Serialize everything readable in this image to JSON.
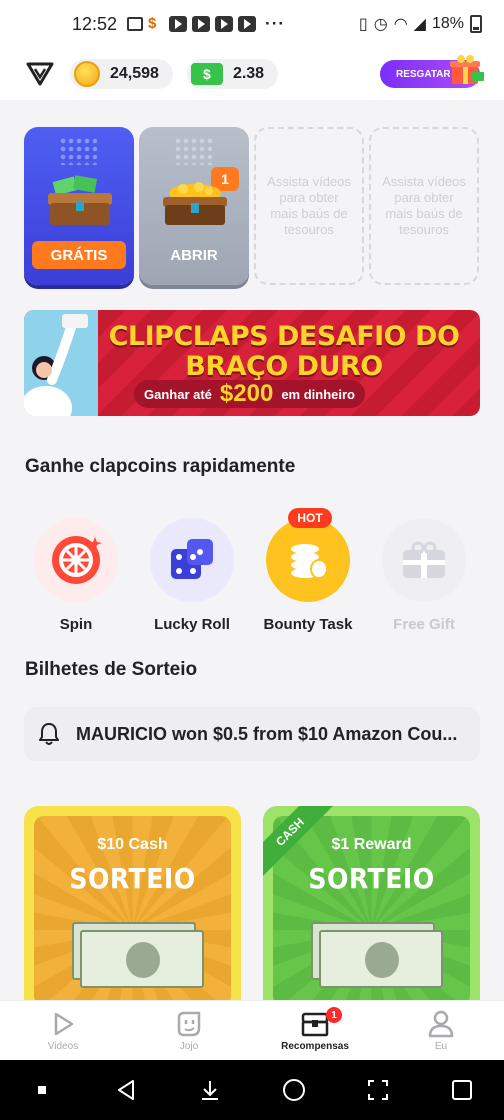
{
  "status_bar": {
    "time": "12:52",
    "battery": "18%"
  },
  "header": {
    "coins": "24,598",
    "cash": "2.38",
    "cash_icon_symbol": "$",
    "redeem_label": "RESGATAR"
  },
  "chests": {
    "free_label": "GRÁTIS",
    "open_label": "ABRIR",
    "open_badge": "1",
    "empty_text": "Assista vídeos para obter mais baús de tesouros"
  },
  "banner": {
    "title": "CLIPCLAPS DESAFIO DO BRAÇO DURO",
    "prefix": "Ganhar até",
    "amount": "$200",
    "suffix": "em dinheiro"
  },
  "quick_section": {
    "title": "Ganhe clapcoins rapidamente",
    "hot_badge": "HOT",
    "items": [
      {
        "label": "Spin",
        "icon": "roulette-wheel-icon"
      },
      {
        "label": "Lucky Roll",
        "icon": "dice-icon"
      },
      {
        "label": "Bounty Task",
        "icon": "coin-stack-icon"
      },
      {
        "label": "Free Gift",
        "icon": "gift-icon"
      }
    ]
  },
  "lottery_section": {
    "title": "Bilhetes de Sorteio",
    "ticker": "MAURICIO won $0.5 from $10 Amazon Cou...",
    "cards": [
      {
        "subtitle": "$10 Cash",
        "title": "SORTEIO",
        "ribbon": ""
      },
      {
        "subtitle": "$1 Reward",
        "title": "SORTEIO",
        "ribbon": "CASH"
      }
    ]
  },
  "bottom_nav": {
    "items": [
      {
        "label": "Videos",
        "icon": "play-icon"
      },
      {
        "label": "Jojo",
        "icon": "jojo-face-icon"
      },
      {
        "label": "Recompensas",
        "icon": "treasure-chest-icon",
        "badge": "1"
      },
      {
        "label": "Eu",
        "icon": "person-icon"
      }
    ]
  },
  "colors": {
    "accent_purple": "#7b2ff7",
    "orange": "#ff7a1f",
    "banner_red": "#d8213a",
    "hot_red": "#ff3b1f"
  }
}
